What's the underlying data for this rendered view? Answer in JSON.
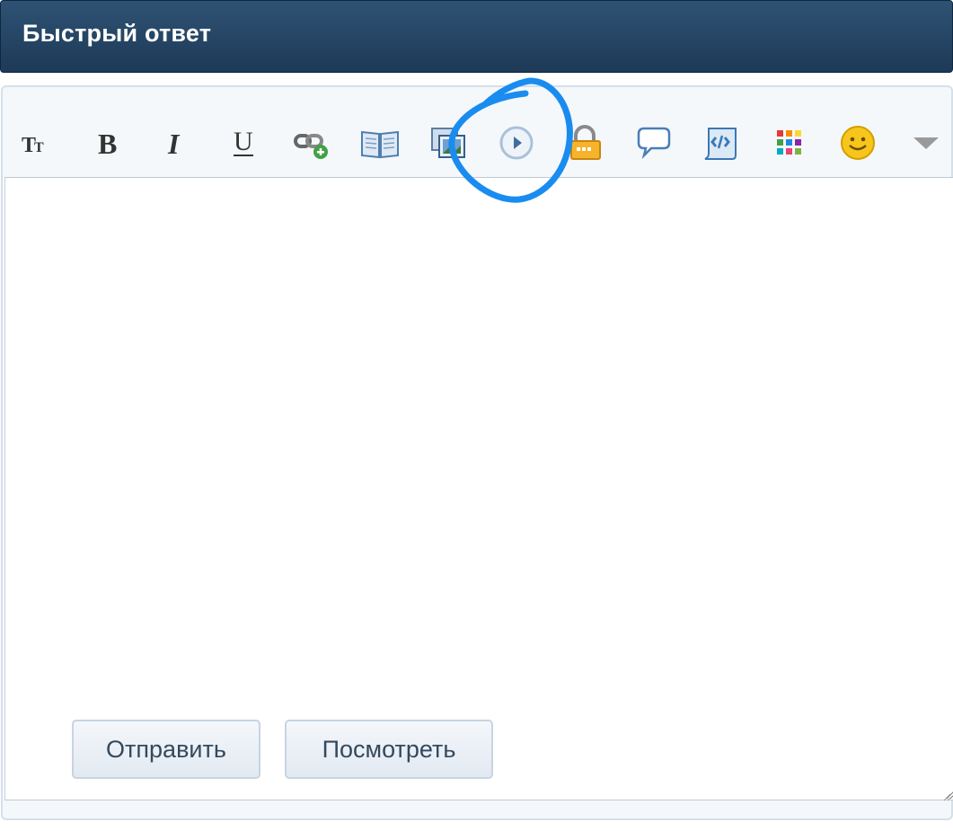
{
  "header": {
    "title": "Быстрый ответ"
  },
  "toolbar": {
    "buttons": [
      {
        "name": "font-size",
        "icon": "font-size-icon"
      },
      {
        "name": "bold",
        "icon": "bold-icon"
      },
      {
        "name": "italic",
        "icon": "italic-icon"
      },
      {
        "name": "underline",
        "icon": "underline-icon"
      },
      {
        "name": "insert-link",
        "icon": "link-add-icon"
      },
      {
        "name": "insert-book",
        "icon": "book-icon"
      },
      {
        "name": "insert-image",
        "icon": "image-icon"
      },
      {
        "name": "insert-media",
        "icon": "play-icon"
      },
      {
        "name": "insert-spoiler",
        "icon": "lock-icon"
      },
      {
        "name": "insert-quote",
        "icon": "speech-bubble-icon"
      },
      {
        "name": "insert-code",
        "icon": "code-scroll-icon"
      },
      {
        "name": "text-color",
        "icon": "color-grid-icon"
      },
      {
        "name": "insert-smiley",
        "icon": "smiley-icon"
      },
      {
        "name": "more-options",
        "icon": "dropdown-arrow-icon"
      }
    ]
  },
  "editor": {
    "value": ""
  },
  "actions": {
    "submit_label": "Отправить",
    "preview_label": "Посмотреть"
  },
  "colors": {
    "header_bg": "#24445f",
    "panel_bg": "#f5f8fb",
    "annotation": "#1a8cf0"
  }
}
